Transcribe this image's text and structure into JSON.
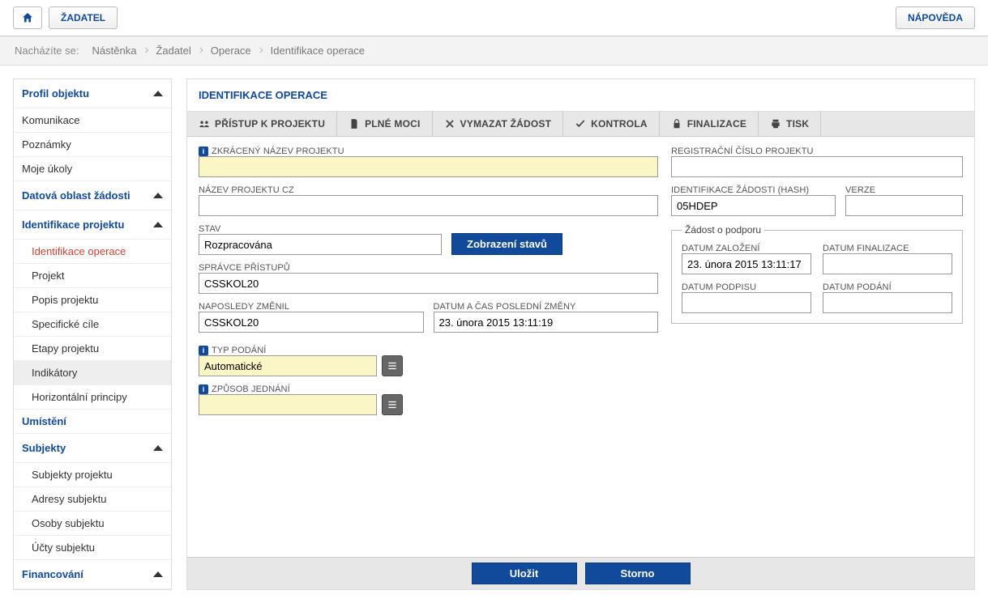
{
  "topbar": {
    "applicant": "ŽADATEL",
    "help": "NÁPOVĚDA"
  },
  "breadcrumb": {
    "label": "Nacházíte se:",
    "items": [
      "Nástěnka",
      "Žadatel",
      "Operace",
      "Identifikace operace"
    ]
  },
  "sidebar": {
    "profile_header": "Profil objektu",
    "profile_items": [
      "Komunikace",
      "Poznámky",
      "Moje úkoly"
    ],
    "data_header": "Datová oblast žádosti",
    "ident_header": "Identifikace projektu",
    "ident_items": [
      "Identifikace operace",
      "Projekt",
      "Popis projektu",
      "Specifické cíle",
      "Etapy projektu",
      "Indikátory",
      "Horizontální principy"
    ],
    "placement": "Umístění",
    "subjects_header": "Subjekty",
    "subjects_items": [
      "Subjekty projektu",
      "Adresy subjektu",
      "Osoby subjektu",
      "Účty subjektu"
    ],
    "financing_header": "Financování"
  },
  "main": {
    "title": "IDENTIFIKACE OPERACE"
  },
  "toolbar": {
    "access": "PŘÍSTUP K PROJEKTU",
    "powers": "PLNÉ MOCI",
    "delete": "VYMAZAT ŽÁDOST",
    "check": "KONTROLA",
    "finalize": "FINALIZACE",
    "print": "TISK"
  },
  "form": {
    "short_name_label": "ZKRÁCENÝ NÁZEV PROJEKTU",
    "short_name_value": "",
    "name_cz_label": "NÁZEV PROJEKTU CZ",
    "name_cz_value": "",
    "state_label": "STAV",
    "state_value": "Rozpracována",
    "show_states_btn": "Zobrazení stavů",
    "access_admin_label": "SPRÁVCE PŘÍSTUPŮ",
    "access_admin_value": "CSSKOL20",
    "last_changed_by_label": "NAPOSLEDY ZMĚNIL",
    "last_changed_by_value": "CSSKOL20",
    "last_change_dt_label": "DATUM A ČAS POSLEDNÍ ZMĚNY",
    "last_change_dt_value": "23. února 2015 13:11:19",
    "submission_type_label": "TYP PODÁNÍ",
    "submission_type_value": "Automatické",
    "acting_mode_label": "ZPŮSOB JEDNÁNÍ",
    "acting_mode_value": "",
    "reg_no_label": "REGISTRAČNÍ ČÍSLO PROJEKTU",
    "reg_no_value": "",
    "hash_label": "IDENTIFIKACE ŽÁDOSTI (HASH)",
    "hash_value": "05HDEP",
    "version_label": "VERZE",
    "version_value": "",
    "support_box_legend": "Žádost o podporu",
    "created_label": "DATUM ZALOŽENÍ",
    "created_value": "23. února 2015 13:11:17",
    "finalized_label": "DATUM FINALIZACE",
    "finalized_value": "",
    "signed_label": "DATUM PODPISU",
    "signed_value": "",
    "submitted_label": "DATUM PODÁNÍ",
    "submitted_value": ""
  },
  "bottom": {
    "save": "Uložit",
    "cancel": "Storno"
  }
}
